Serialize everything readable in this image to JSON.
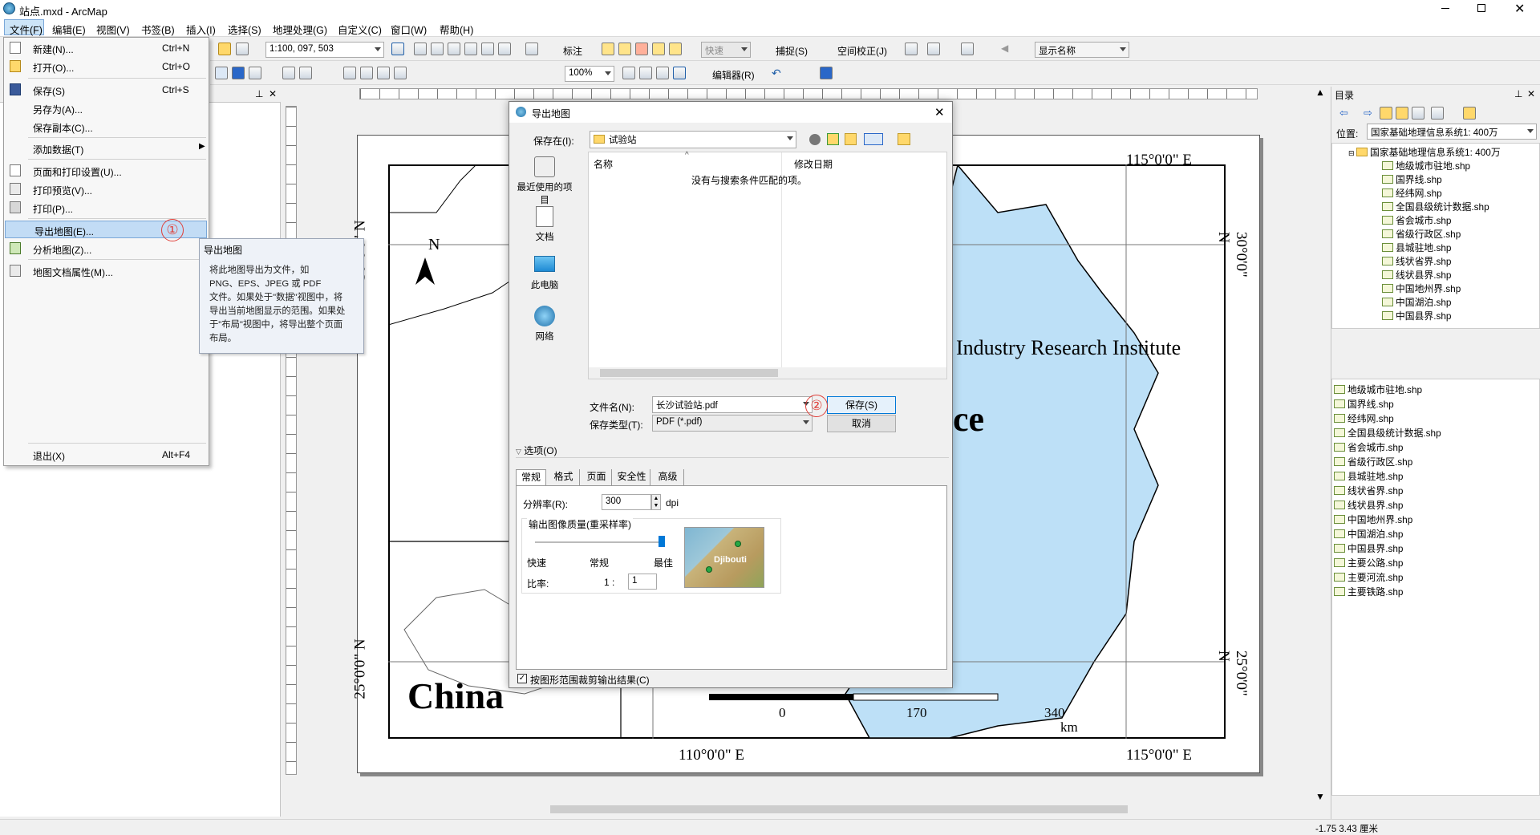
{
  "window": {
    "title": "站点.mxd - ArcMap"
  },
  "menubar": [
    "文件(F)",
    "编辑(E)",
    "视图(V)",
    "书签(B)",
    "插入(I)",
    "选择(S)",
    "地理处理(G)",
    "自定义(C)",
    "窗口(W)",
    "帮助(H)"
  ],
  "toolbar": {
    "scale": "1:100, 097, 503",
    "zoom": "100%",
    "label_menu": "标注",
    "speed": "快速",
    "snap": "捕捉(S)",
    "georef": "空间校正(J)",
    "display_name": "显示名称",
    "editor": "编辑器(R)"
  },
  "file_menu": {
    "items": [
      {
        "label": "新建(N)...",
        "shortcut": "Ctrl+N"
      },
      {
        "label": "打开(O)...",
        "shortcut": "Ctrl+O"
      },
      {
        "label": "保存(S)",
        "shortcut": "Ctrl+S"
      },
      {
        "label": "另存为(A)...",
        "shortcut": ""
      },
      {
        "label": "保存副本(C)...",
        "shortcut": ""
      },
      {
        "label": "添加数据(T)",
        "shortcut": ""
      },
      {
        "label": "页面和打印设置(U)...",
        "shortcut": ""
      },
      {
        "label": "打印预览(V)...",
        "shortcut": ""
      },
      {
        "label": "打印(P)...",
        "shortcut": ""
      },
      {
        "label": "导出地图(E)...",
        "shortcut": ""
      },
      {
        "label": "分析地图(Z)...",
        "shortcut": ""
      },
      {
        "label": "地图文档属性(M)...",
        "shortcut": ""
      },
      {
        "label": "退出(X)",
        "shortcut": "Alt+F4"
      }
    ]
  },
  "annotations": {
    "one": "①",
    "two": "②"
  },
  "tooltip": {
    "title": "导出地图",
    "lines": [
      "将此地图导出为文件，如",
      "PNG、EPS、JPEG 或 PDF",
      "文件。如果处于\"数据\"视图中，将",
      "导出当前地图显示的范围。如果处",
      "于\"布局\"视图中，将导出整个页面",
      "布局。"
    ]
  },
  "map": {
    "top_lon": "115°0'0\" E",
    "bottom_lon_left": "110°0'0\" E",
    "bottom_lon_right": "115°0'0\" E",
    "lat_30": "30°0'0\" N",
    "lat_25": "25°0'0\" N",
    "north": "N",
    "china": "China",
    "institute": "Industry Research Institute",
    "ce": "ce",
    "scale_0": "0",
    "scale_170": "170",
    "scale_340": "340",
    "scale_unit": "km"
  },
  "dialog": {
    "title": "导出地图",
    "save_in_label": "保存在(I):",
    "save_in_value": "试验站",
    "places": [
      "最近使用的项目",
      "文档",
      "此电脑",
      "网络"
    ],
    "col_name": "名称",
    "col_date": "修改日期",
    "empty_msg": "没有与搜索条件匹配的项。",
    "filename_label": "文件名(N):",
    "filename_value": "长沙试验站.pdf",
    "filetype_label": "保存类型(T):",
    "filetype_value": "PDF (*.pdf)",
    "save_btn": "保存(S)",
    "cancel_btn": "取消",
    "options_label": "选项(O)",
    "tabs": [
      "常规",
      "格式",
      "页面",
      "安全性",
      "高级"
    ],
    "resolution_label": "分辨率(R):",
    "resolution_value": "300",
    "dpi": "dpi",
    "quality_label": "输出图像质量(重采样率)",
    "q_fast": "快速",
    "q_normal": "常规",
    "q_best": "最佳",
    "ratio_label": "比率:",
    "ratio_left": "1 :",
    "ratio_value": "1",
    "preview_label": "Djibouti",
    "clip_label": "按图形范围裁剪输出结果(C)"
  },
  "catalog": {
    "title": "目录",
    "location_label": "位置:",
    "location_value": "国家基础地理信息系统1: 400万",
    "root": "国家基础地理信息系统1: 400万",
    "files": [
      "地级城市驻地.shp",
      "国界线.shp",
      "经纬网.shp",
      "全国县级统计数据.shp",
      "省会城市.shp",
      "省级行政区.shp",
      "县城驻地.shp",
      "线状省界.shp",
      "线状县界.shp",
      "中国地州界.shp",
      "中国湖泊.shp",
      "中国县界.shp",
      "主要公路.shp",
      "主要河流.shp",
      "主要铁路.shp"
    ]
  },
  "status": {
    "coords": "-1.75  3.43 厘米"
  },
  "colors": {
    "selection": "#c2dcf5",
    "water": "#bde0f7",
    "accent": "#e0403a"
  }
}
